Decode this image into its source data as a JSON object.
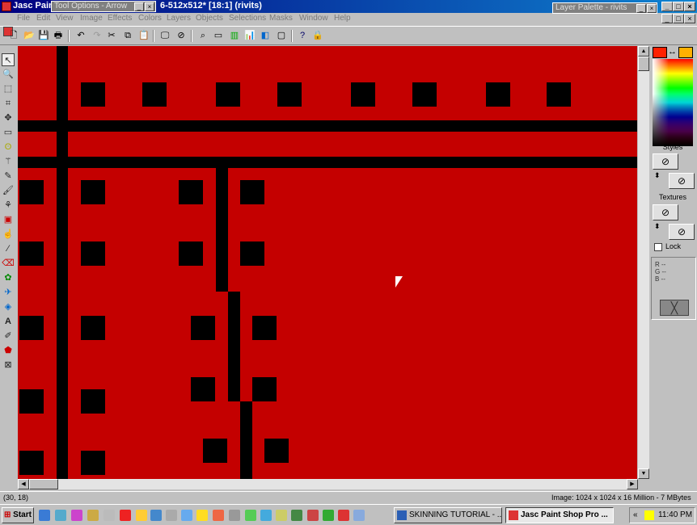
{
  "window": {
    "app_title": "Jasc Pain",
    "doc_title": "6-512x512* [18:1] (rivits)"
  },
  "tool_options": {
    "title": "Tool Options - Arrow"
  },
  "layer_palette": {
    "title": "Layer Palette - rivits"
  },
  "menu": [
    "File",
    "Edit",
    "View",
    "Image",
    "Effects",
    "Colors",
    "Layers",
    "Objects",
    "Selections",
    "Masks",
    "Window",
    "Help"
  ],
  "palette": {
    "styles_label": "Styles",
    "textures_label": "Textures",
    "lock_label": "Lock",
    "rgb": [
      "R  --",
      "G  --",
      "B  --"
    ],
    "foreground_color": "#ff2000",
    "background_color": "#ffb000"
  },
  "status": {
    "coords": "(30, 18)",
    "image_info": "Image:  1024 x 1024 x 16 Million - 7 MBytes"
  },
  "taskbar": {
    "start_label": "Start",
    "tasks": [
      "SKINNING TUTORIAL - ...",
      "Jasc Paint Shop Pro ..."
    ],
    "clock": "11:40 PM"
  },
  "colors": {
    "canvas": "#c40000",
    "rivet": "#000000"
  }
}
